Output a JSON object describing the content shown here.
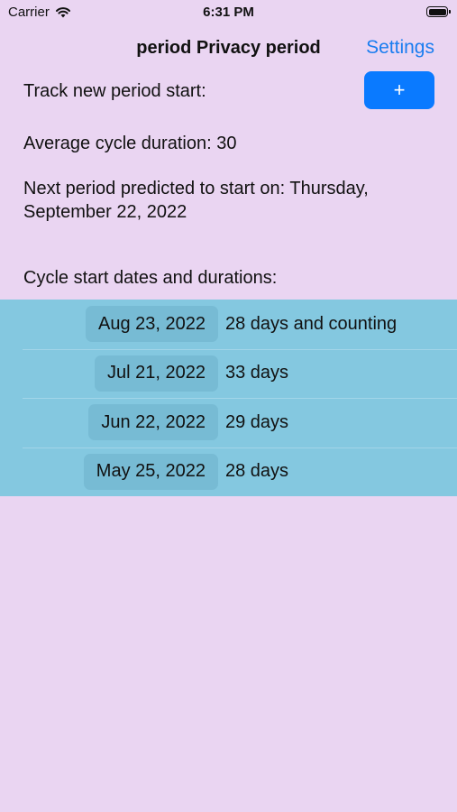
{
  "status_bar": {
    "carrier": "Carrier",
    "time": "6:31 PM",
    "wifi_icon": "wifi-icon",
    "battery_icon": "battery-icon"
  },
  "nav": {
    "title": "period Privacy period",
    "settings_label": "Settings"
  },
  "track": {
    "label": "Track new period start:",
    "add_label": "+",
    "add_color": "#0A7AFF"
  },
  "average_text": "Average cycle duration: 30",
  "next_text": "Next period predicted to start on: Thursday, September 22, 2022",
  "cycles": {
    "header": "Cycle start dates and durations:",
    "items": [
      {
        "date": "Aug 23, 2022",
        "duration": "28 days and counting"
      },
      {
        "date": "Jul 21, 2022",
        "duration": "33 days"
      },
      {
        "date": "Jun 22, 2022",
        "duration": "29 days"
      },
      {
        "date": "May 25, 2022",
        "duration": "28 days"
      }
    ]
  },
  "colors": {
    "background": "#EAD5F2",
    "list_background": "#84C8E0",
    "accent": "#1A7DF0"
  }
}
